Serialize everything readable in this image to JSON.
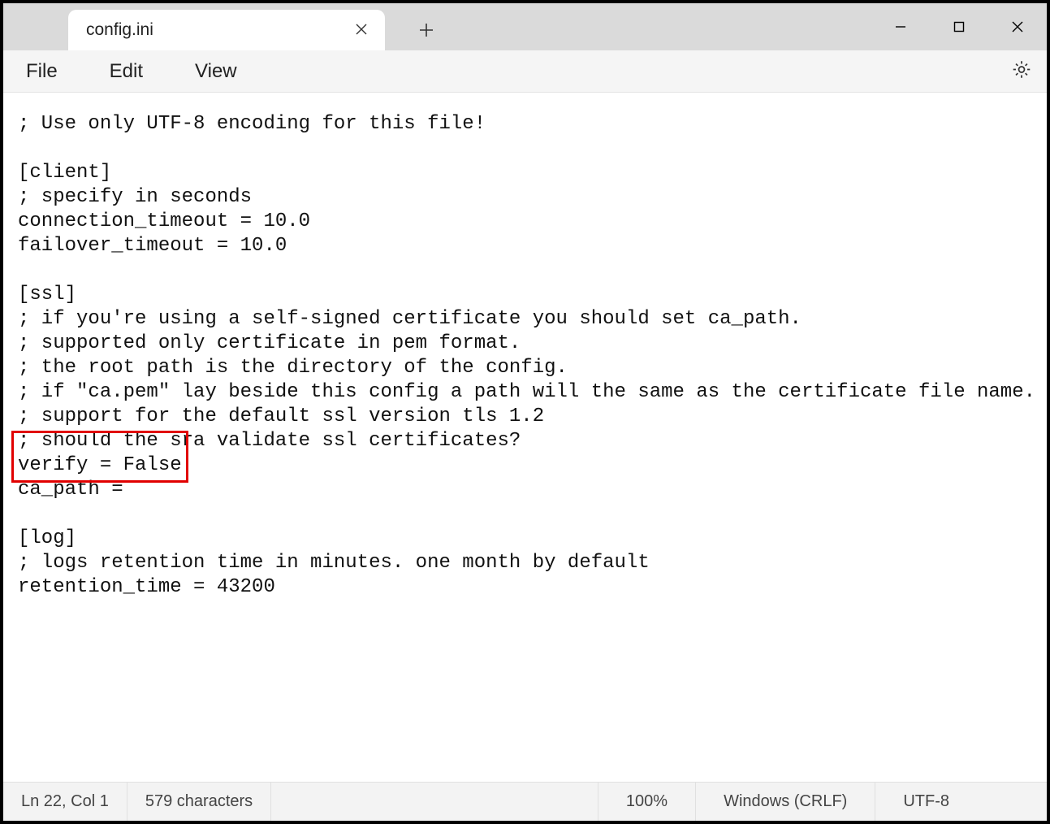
{
  "tab": {
    "title": "config.ini"
  },
  "menu": {
    "file": "File",
    "edit": "Edit",
    "view": "View"
  },
  "editor": {
    "lines": [
      "; Use only UTF-8 encoding for this file!",
      "",
      "[client]",
      "; specify in seconds",
      "connection_timeout = 10.0",
      "failover_timeout = 10.0",
      "",
      "[ssl]",
      "; if you're using a self-signed certificate you should set ca_path.",
      "; supported only certificate in pem format.",
      "; the root path is the directory of the config.",
      "; if \"ca.pem\" lay beside this config a path will the same as the certificate file name.",
      "; support for the default ssl version tls 1.2",
      "; should the sra validate ssl certificates?",
      "verify = False",
      "ca_path =",
      "",
      "[log]",
      "; logs retention time in minutes. one month by default",
      "retention_time = 43200"
    ]
  },
  "status": {
    "position": "Ln 22, Col 1",
    "chars": "579 characters",
    "zoom": "100%",
    "line_endings": "Windows (CRLF)",
    "encoding": "UTF-8"
  },
  "highlight": {
    "color": "#e10000"
  }
}
